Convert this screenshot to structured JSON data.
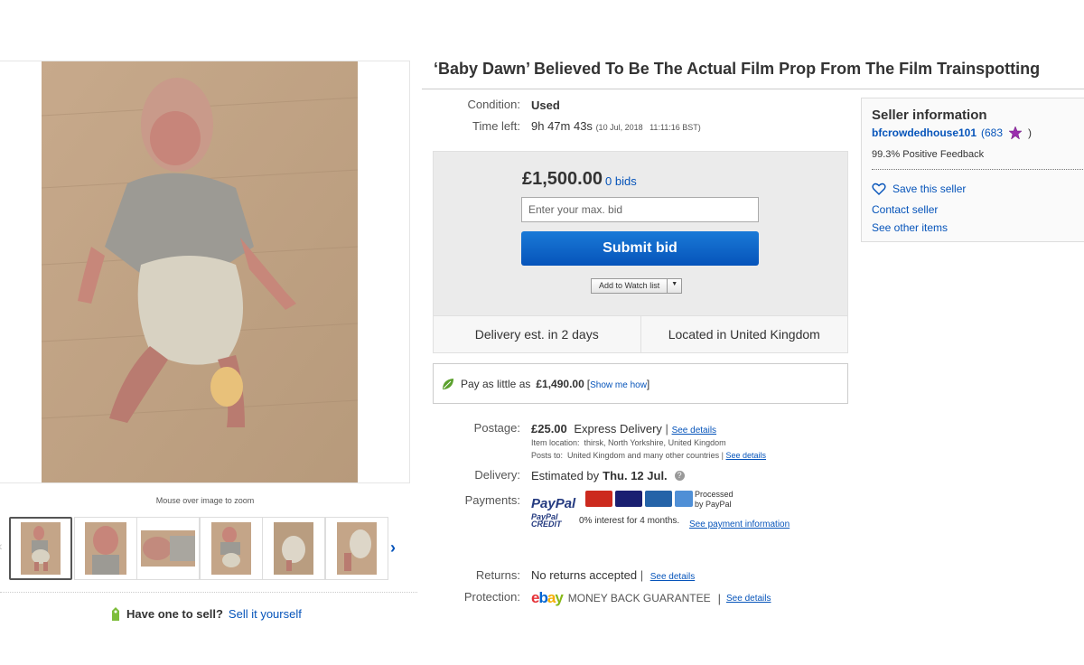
{
  "gallery": {
    "zoom_hint": "Mouse over image to zoom",
    "thumb_count": 6,
    "prev_icon": "chevron-left-icon",
    "next_icon": "chevron-right-icon"
  },
  "sell": {
    "prompt": "Have one to sell?",
    "link": "Sell it yourself",
    "icon": "tag-icon"
  },
  "item": {
    "title": "‘Baby Dawn’ Believed To Be The Actual Film Prop From The Film Trainspotting"
  },
  "condition": {
    "label": "Condition:",
    "value": "Used"
  },
  "time_left": {
    "label": "Time left:",
    "value": "9h 47m 43s",
    "end": "(10 Jul, 2018   11:11:16 BST)"
  },
  "bid": {
    "price": "£1,500.00",
    "bids": "0 bids",
    "placeholder": "Enter your max. bid",
    "submit_label": "Submit bid",
    "watch_label": "Add to Watch list",
    "accent": "#0654ba"
  },
  "delivery_bar": {
    "estimate": "Delivery est. in 2 days",
    "location": "Located in United Kingdom"
  },
  "finance": {
    "text": "Pay as little as",
    "amount": "£1,490.00",
    "bracket_open": "[",
    "link": "Show me how",
    "bracket_close": "]"
  },
  "postage": {
    "label": "Postage:",
    "price": "£25.00",
    "service": "Express Delivery",
    "see_details": "See details",
    "location_line": "Item location:  thirsk, North Yorkshire, United Kingdom",
    "posts_to": "Posts to:  United Kingdom and many other countries",
    "see_details_2": "See details"
  },
  "delivery": {
    "label": "Delivery:",
    "prefix": "Estimated by",
    "date": "Thu. 12 Jul.",
    "help_icon": "help-icon"
  },
  "payments": {
    "label": "Payments:",
    "paypal": "PayPal",
    "processed": "Processed",
    "by_paypal": "by PayPal",
    "credit_label": "PayPal CREDIT",
    "interest": "0% interest for 4 months.",
    "see_info": "See payment information",
    "cards": [
      "MasterCard",
      "VISA",
      "Maestro",
      "AmEx"
    ]
  },
  "returns": {
    "label": "Returns:",
    "value": "No returns accepted",
    "see_details": "See details"
  },
  "protection": {
    "label": "Protection:",
    "guarantee": "MONEY BACK GUARANTEE",
    "see_details": "See details"
  },
  "seller": {
    "heading": "Seller information",
    "name": "bfcrowdedhouse101",
    "score": "(683",
    "close_paren": ")",
    "feedback": "99.3% Positive Feedback",
    "save": "Save this seller",
    "contact": "Contact seller",
    "other": "See other items",
    "star_color": "#9b2fae"
  }
}
